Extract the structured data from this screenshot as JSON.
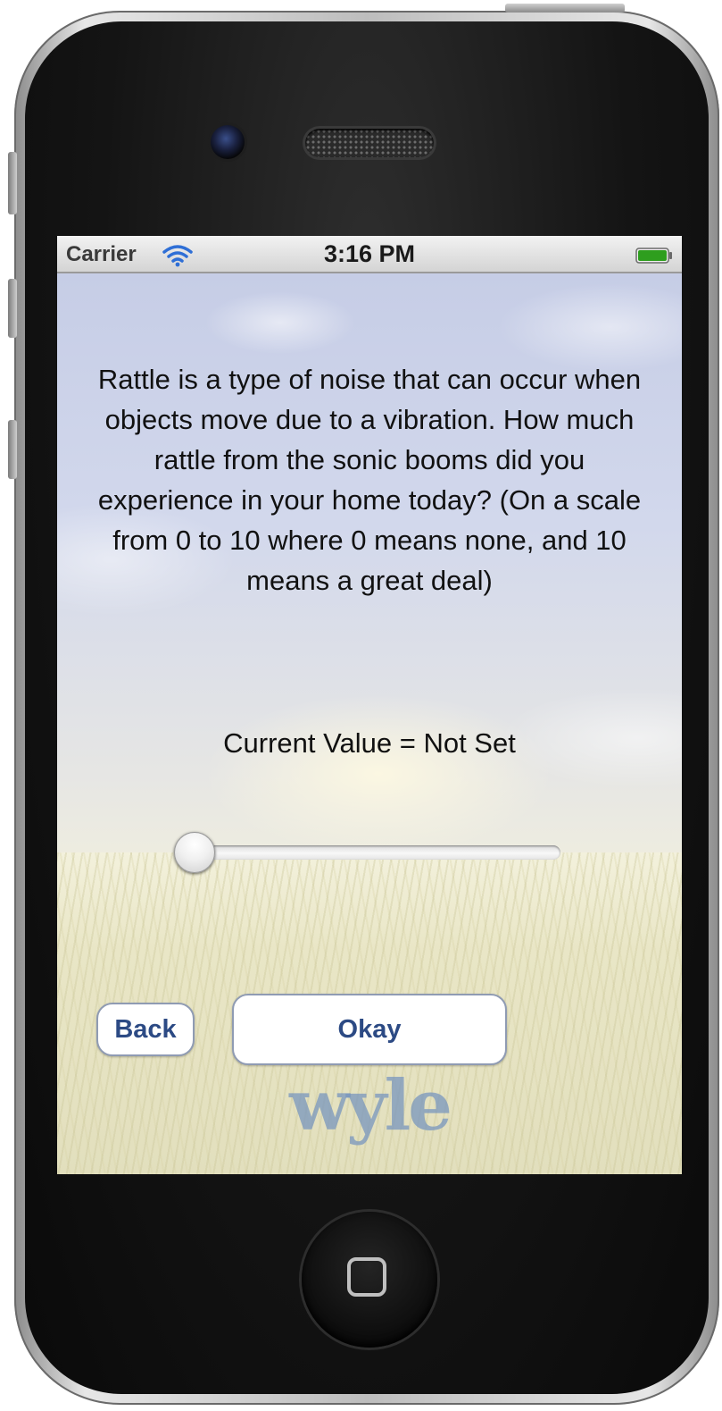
{
  "status_bar": {
    "carrier": "Carrier",
    "wifi_icon": "wifi-icon",
    "time": "3:16 PM",
    "battery_icon": "battery-icon",
    "battery_color": "#2e9e1e"
  },
  "question": {
    "text": "Rattle is a type of noise that can occur when objects move due to a vibration. How much rattle from the sonic booms did you experience in your home today? (On a scale from 0 to 10 where 0 means none, and 10 means a great deal)"
  },
  "current_value": {
    "label": "Current Value",
    "separator": " = ",
    "value": "Not Set"
  },
  "slider": {
    "min": 0,
    "max": 10,
    "position_fraction": 0
  },
  "buttons": {
    "back_label": "Back",
    "okay_label": "Okay",
    "text_color": "#2c4a84"
  },
  "logo": {
    "text": "wyle"
  }
}
